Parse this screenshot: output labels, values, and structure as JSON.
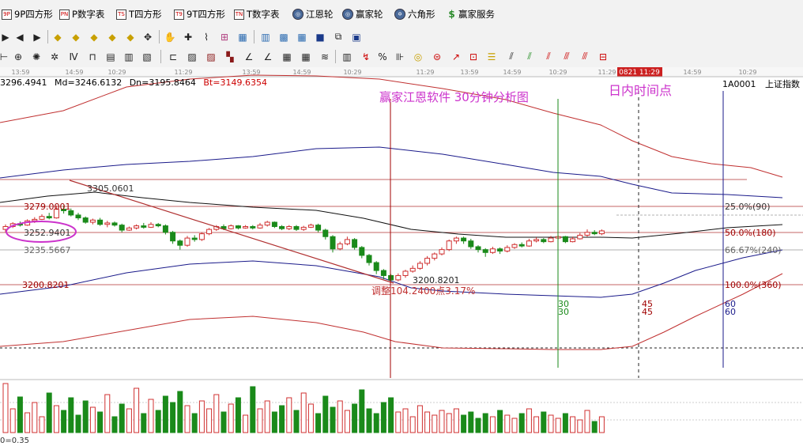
{
  "menu": [
    {
      "icon": "9P",
      "label": "9P四方形",
      "name": "9p-square"
    },
    {
      "icon": "PN",
      "label": "P数字表",
      "name": "p-number-table"
    },
    {
      "icon": "TS",
      "label": "T四方形",
      "name": "t-square"
    },
    {
      "icon": "T9",
      "label": "9T四方形",
      "name": "9t-square"
    },
    {
      "icon": "TN",
      "label": "T数字表",
      "name": "t-number-table"
    },
    {
      "icon": "◎",
      "label": "江恩轮",
      "name": "gann-wheel"
    },
    {
      "icon": "◎",
      "label": "赢家轮",
      "name": "winner-wheel"
    },
    {
      "icon": "✡",
      "label": "六角形",
      "name": "hexagon"
    },
    {
      "icon": "$",
      "label": "赢家服务",
      "name": "winner-service"
    }
  ],
  "time_axis": [
    "13:59",
    "14:59",
    "10:29",
    "11:29",
    "13:59",
    "14:59",
    "10:29",
    "11:29",
    "13:59",
    "14:59",
    "10:29",
    "11:29",
    "13:59",
    "14:59",
    "10:29",
    "11:29",
    "13:59",
    "14:59"
  ],
  "cursor_time": "0821 11:29",
  "info": {
    "up": "3296.4941",
    "md_label": "Md=",
    "md": "3246.6132",
    "dn_label": "Dn=",
    "dn": "3195.8464",
    "bt_label": "Bt=",
    "bt": "3149.6354"
  },
  "symbol": {
    "code": "1A0001",
    "name": "上证指数"
  },
  "annotations": {
    "title": "赢家江恩软件 30分钟分析图",
    "intraday": "日内时间点",
    "adjust": "调整104.2400点3.17%"
  },
  "price_labels": {
    "high": "3305.0601",
    "p1": "3279.0001",
    "p2": "3252.9401",
    "p3": "3235.5667",
    "low_left": "3200.8201",
    "low": "3200.8201"
  },
  "fib_labels": [
    "25.0%(90)",
    "50.0%(180)",
    "66.67%(240)",
    "100.0%(360)"
  ],
  "cycle_labels": [
    "30",
    "30",
    "45",
    "45",
    "60",
    "60"
  ],
  "volume_label": "0=0.35",
  "colors": {
    "up": "#d03030",
    "down": "#1a8a1a",
    "band": "#c03030",
    "ma": "#1a1a8a",
    "purple": "#cc33cc",
    "red_line": "#a00000"
  },
  "chart_data": {
    "type": "candlestick",
    "title": "赢家江恩软件 30分钟分析图",
    "ylim": [
      3140,
      3320
    ],
    "levels": [
      3305.0601,
      3279.0001,
      3252.9401,
      3235.5667,
      3200.8201
    ],
    "candles": [
      [
        3272,
        3276,
        3268,
        3279
      ],
      [
        3276,
        3280,
        3274,
        3282
      ],
      [
        3280,
        3278,
        3276,
        3283
      ],
      [
        3278,
        3284,
        3277,
        3286
      ],
      [
        3284,
        3286,
        3281,
        3289
      ],
      [
        3286,
        3290,
        3285,
        3293
      ],
      [
        3290,
        3288,
        3286,
        3295
      ],
      [
        3288,
        3300,
        3287,
        3305
      ],
      [
        3300,
        3298,
        3294,
        3305
      ],
      [
        3298,
        3292,
        3290,
        3301
      ],
      [
        3292,
        3288,
        3285,
        3295
      ],
      [
        3288,
        3282,
        3280,
        3290
      ],
      [
        3282,
        3285,
        3279,
        3287
      ],
      [
        3285,
        3279,
        3277,
        3288
      ],
      [
        3279,
        3281,
        3275,
        3284
      ],
      [
        3281,
        3278,
        3276,
        3283
      ],
      [
        3278,
        3271,
        3268,
        3280
      ],
      [
        3271,
        3274,
        3270,
        3276
      ],
      [
        3274,
        3277,
        3272,
        3279
      ],
      [
        3277,
        3275,
        3273,
        3281
      ],
      [
        3275,
        3279,
        3274,
        3282
      ],
      [
        3279,
        3277,
        3275,
        3281
      ],
      [
        3277,
        3268,
        3265,
        3279
      ],
      [
        3268,
        3256,
        3252,
        3270
      ],
      [
        3256,
        3250,
        3244,
        3258
      ],
      [
        3250,
        3260,
        3248,
        3263
      ],
      [
        3260,
        3258,
        3255,
        3264
      ],
      [
        3258,
        3266,
        3256,
        3268
      ],
      [
        3266,
        3272,
        3264,
        3274
      ],
      [
        3272,
        3276,
        3270,
        3278
      ],
      [
        3276,
        3273,
        3271,
        3279
      ],
      [
        3273,
        3277,
        3272,
        3279
      ],
      [
        3277,
        3274,
        3272,
        3278
      ],
      [
        3274,
        3276,
        3273,
        3278
      ],
      [
        3276,
        3274,
        3272,
        3278
      ],
      [
        3274,
        3278,
        3273,
        3281
      ],
      [
        3278,
        3282,
        3276,
        3284
      ],
      [
        3282,
        3276,
        3274,
        3283
      ],
      [
        3276,
        3273,
        3271,
        3278
      ],
      [
        3273,
        3276,
        3271,
        3278
      ],
      [
        3276,
        3272,
        3270,
        3278
      ],
      [
        3272,
        3275,
        3270,
        3277
      ],
      [
        3275,
        3278,
        3274,
        3280
      ],
      [
        3278,
        3271,
        3268,
        3280
      ],
      [
        3271,
        3262,
        3258,
        3273
      ],
      [
        3262,
        3245,
        3240,
        3264
      ],
      [
        3245,
        3252,
        3243,
        3255
      ],
      [
        3252,
        3258,
        3250,
        3262
      ],
      [
        3258,
        3247,
        3244,
        3260
      ],
      [
        3247,
        3236,
        3232,
        3249
      ],
      [
        3236,
        3226,
        3222,
        3238
      ],
      [
        3226,
        3215,
        3210,
        3228
      ],
      [
        3215,
        3208,
        3203,
        3217
      ],
      [
        3208,
        3202,
        3200,
        3210
      ],
      [
        3202,
        3208,
        3200,
        3211
      ],
      [
        3208,
        3214,
        3205,
        3216
      ],
      [
        3214,
        3218,
        3212,
        3222
      ],
      [
        3218,
        3225,
        3216,
        3228
      ],
      [
        3225,
        3232,
        3222,
        3235
      ],
      [
        3232,
        3238,
        3229,
        3240
      ],
      [
        3238,
        3244,
        3236,
        3247
      ],
      [
        3244,
        3256,
        3242,
        3258
      ],
      [
        3256,
        3260,
        3252,
        3262
      ],
      [
        3260,
        3256,
        3252,
        3262
      ],
      [
        3256,
        3248,
        3245,
        3259
      ],
      [
        3248,
        3244,
        3240,
        3250
      ],
      [
        3244,
        3240,
        3234,
        3246
      ],
      [
        3240,
        3245,
        3238,
        3248
      ],
      [
        3245,
        3242,
        3238,
        3247
      ],
      [
        3242,
        3247,
        3240,
        3250
      ],
      [
        3247,
        3251,
        3245,
        3253
      ],
      [
        3251,
        3249,
        3247,
        3254
      ],
      [
        3249,
        3256,
        3248,
        3259
      ],
      [
        3256,
        3258,
        3254,
        3261
      ],
      [
        3258,
        3255,
        3253,
        3260
      ],
      [
        3255,
        3260,
        3254,
        3263
      ],
      [
        3260,
        3262,
        3258,
        3264
      ],
      [
        3262,
        3255,
        3253,
        3263
      ],
      [
        3255,
        3259,
        3254,
        3262
      ],
      [
        3259,
        3264,
        3258,
        3267
      ],
      [
        3264,
        3268,
        3262,
        3272
      ],
      [
        3268,
        3266,
        3264,
        3271
      ],
      [
        3266,
        3270,
        3264,
        3272
      ]
    ]
  }
}
